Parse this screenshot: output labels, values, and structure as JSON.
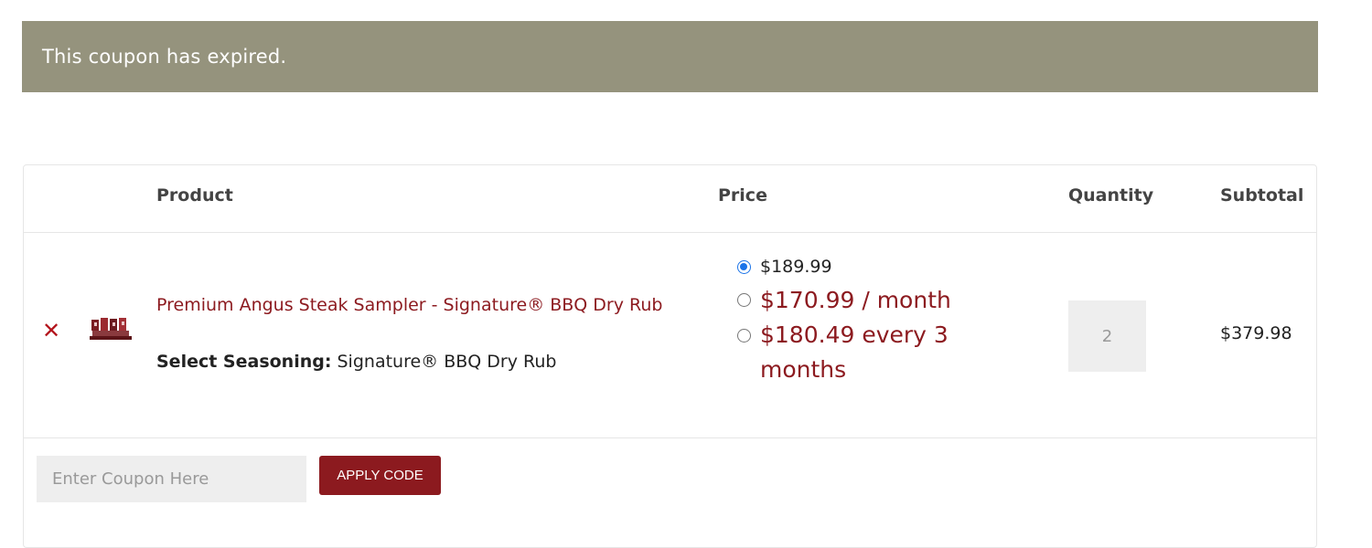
{
  "notice": {
    "message": "This coupon has expired.",
    "background": "#95937d"
  },
  "cart": {
    "headers": {
      "product": "Product",
      "price": "Price",
      "quantity": "Quantity",
      "subtotal": "Subtotal"
    },
    "items": [
      {
        "remove_icon": "close-icon",
        "remove_glyph": "✕",
        "name": "Premium Angus Steak Sampler - Signature® BBQ Dry Rub",
        "attribute_label": "Select Seasoning:",
        "attribute_value": "Signature® BBQ Dry Rub",
        "price_options": [
          {
            "label": "$189.99",
            "selected": true
          },
          {
            "label": "$170.99 / month",
            "selected": false
          },
          {
            "label": "$180.49 every 3 months",
            "selected": false
          }
        ],
        "quantity": "2",
        "subtotal": "$379.98"
      }
    ],
    "coupon": {
      "placeholder": "Enter Coupon Here",
      "apply_label": "APPLY CODE"
    }
  },
  "colors": {
    "accent": "#8c1a1f",
    "remove": "#b3141c",
    "radio_selected": "#1a73e8"
  }
}
